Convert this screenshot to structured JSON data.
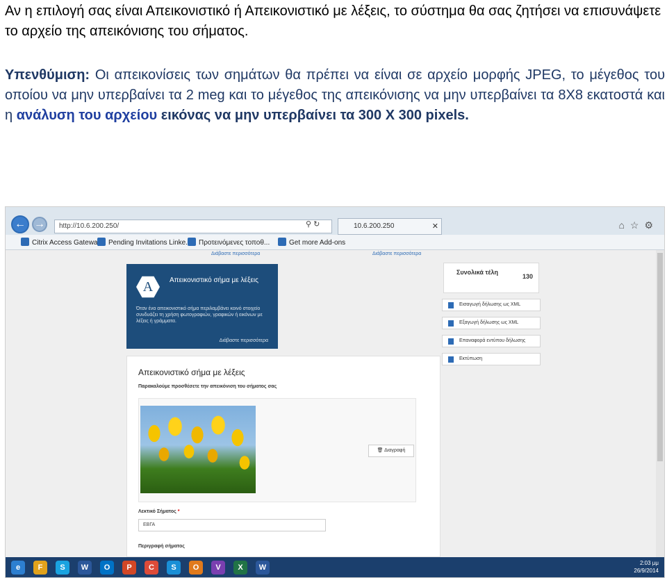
{
  "intro_text": "Αν η επιλογή σας είναι Απεικονιστικό ή Απεικονιστικό με λέξεις, το σύστημα θα σας ζητήσει να επισυνάψετε το αρχείο της απεικόνισης του σήματος.",
  "reminder": {
    "label": "Υπενθύμιση:",
    "text1": " Οι απεικονίσεις των σημάτων θα πρέπει να είναι σε αρχείο μορφής JPEG, το μέγεθος του οποίου να μην υπερβαίνει τα 2 meg και το μέγεθος της απεικόνισης να μην υπερβαίνει τα 8Χ8 εκατοστά και η ",
    "highlight": "ανάλυση του αρχείου",
    "bold_end": " εικόνας να μην υπερβαίνει τα 300 Χ 300 pixels."
  },
  "screenshot": {
    "address": "http://10.6.200.250/",
    "tab_title": "10.6.200.250",
    "favorites": [
      "Citrix Access Gateway",
      "Pending Invitations Linke...",
      "Προτεινόμενες τοποθ...",
      "Get more Add-ons"
    ],
    "top_links": [
      "Διάβαστε περισσότερα",
      "Διάβαστε περισσότερα"
    ],
    "panel": {
      "logo_letter": "A",
      "title": "Απεικονιστικό σήμα με λέξεις",
      "description": "Όταν ένα απεικονιστικό σήμα περιλαμβάνει κοινό στοιχείο συνδυάζει τη χρήση φωτογραφιών, γραφικών ή εικόνων με λέξεις ή γράμματα.",
      "link": "Διάβαστε περισσότερα"
    },
    "side": {
      "total_label": "Συνολικά τέλη",
      "total_value": "130",
      "buttons": [
        "Εισαγωγή δήλωσης ως XML",
        "Εξαγωγή δήλωσης ως XML",
        "Επαναφορά εντύπου δήλωσης",
        "Εκτύπωση"
      ]
    },
    "form": {
      "title": "Απεικονιστικό σήμα με λέξεις",
      "subtitle": "Παρακαλούμε προσθέσετε την απεικόνιση του σήματος σας",
      "delete_button": "Διαγραφή",
      "field1_label": "Λεκτικό Σήματος",
      "field1_required": "*",
      "field1_value": "ΕΒΓΑ",
      "field2_label": "Περιγραφή σήματος"
    },
    "taskbar": {
      "icons": [
        "e",
        "F",
        "S",
        "W",
        "O",
        "P",
        "C",
        "S",
        "O",
        "V",
        "X",
        "W"
      ],
      "time": "2:03 μμ",
      "date": "26/9/2014"
    }
  }
}
